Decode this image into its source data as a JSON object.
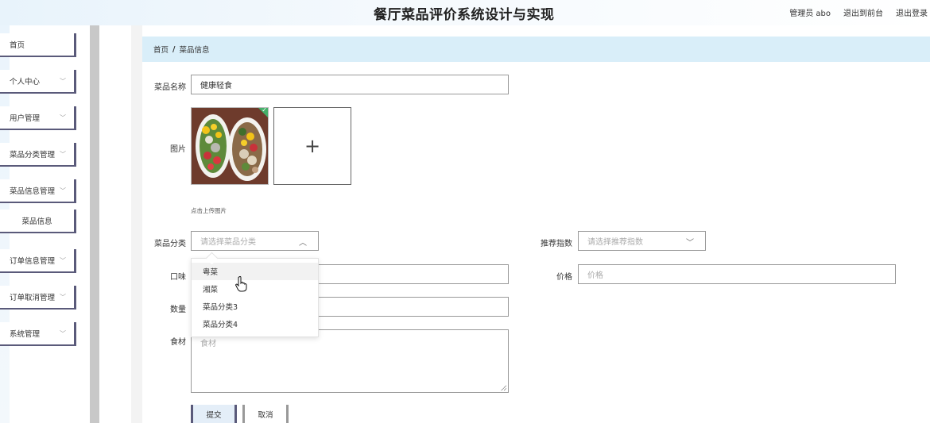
{
  "header": {
    "title": "餐厅菜品评价系统设计与实现",
    "admin": "管理员 abo",
    "back_to_front": "退出到前台",
    "logout": "退出登录"
  },
  "sidebar": {
    "items": [
      {
        "label": "首页",
        "has_chevron": false
      },
      {
        "label": "个人中心",
        "has_chevron": true
      },
      {
        "label": "用户管理",
        "has_chevron": true
      },
      {
        "label": "菜品分类管理",
        "has_chevron": true
      },
      {
        "label": "菜品信息管理",
        "has_chevron": true
      },
      {
        "label": "菜品信息",
        "has_chevron": false
      },
      {
        "label": "订单信息管理",
        "has_chevron": true
      },
      {
        "label": "订单取消管理",
        "has_chevron": true
      },
      {
        "label": "系统管理",
        "has_chevron": true
      }
    ]
  },
  "breadcrumb": {
    "home": "首页",
    "separator": "/",
    "current": "菜品信息"
  },
  "form": {
    "name_label": "菜品名称",
    "name_value": "健康轻食",
    "image_label": "图片",
    "upload_plus": "+",
    "upload_hint": "点击上传图片",
    "category_label": "菜品分类",
    "category_placeholder": "请选择菜品分类",
    "recommend_label": "推荐指数",
    "recommend_placeholder": "请选择推荐指数",
    "taste_label": "口味",
    "price_label": "价格",
    "price_placeholder": "价格",
    "quantity_label": "数量",
    "ingredients_label": "食材",
    "ingredients_placeholder": "食材",
    "submit": "提交",
    "cancel": "取消"
  },
  "dropdown": {
    "options": [
      "粤菜",
      "湘菜",
      "菜品分类3",
      "菜品分类4"
    ],
    "hovered_index": 0
  },
  "icons": {
    "chevron_down": "chevron-down-icon",
    "chevron_up": "chevron-up-icon",
    "plus": "plus-icon",
    "hand_cursor": "hand-cursor-icon",
    "check": "check-icon"
  },
  "colors": {
    "header_bg": "#e8f3fb",
    "breadcrumb_bg": "#d9eef9",
    "menu_border": "#5a5a7a",
    "scrollbar": "#c8c8c8"
  }
}
